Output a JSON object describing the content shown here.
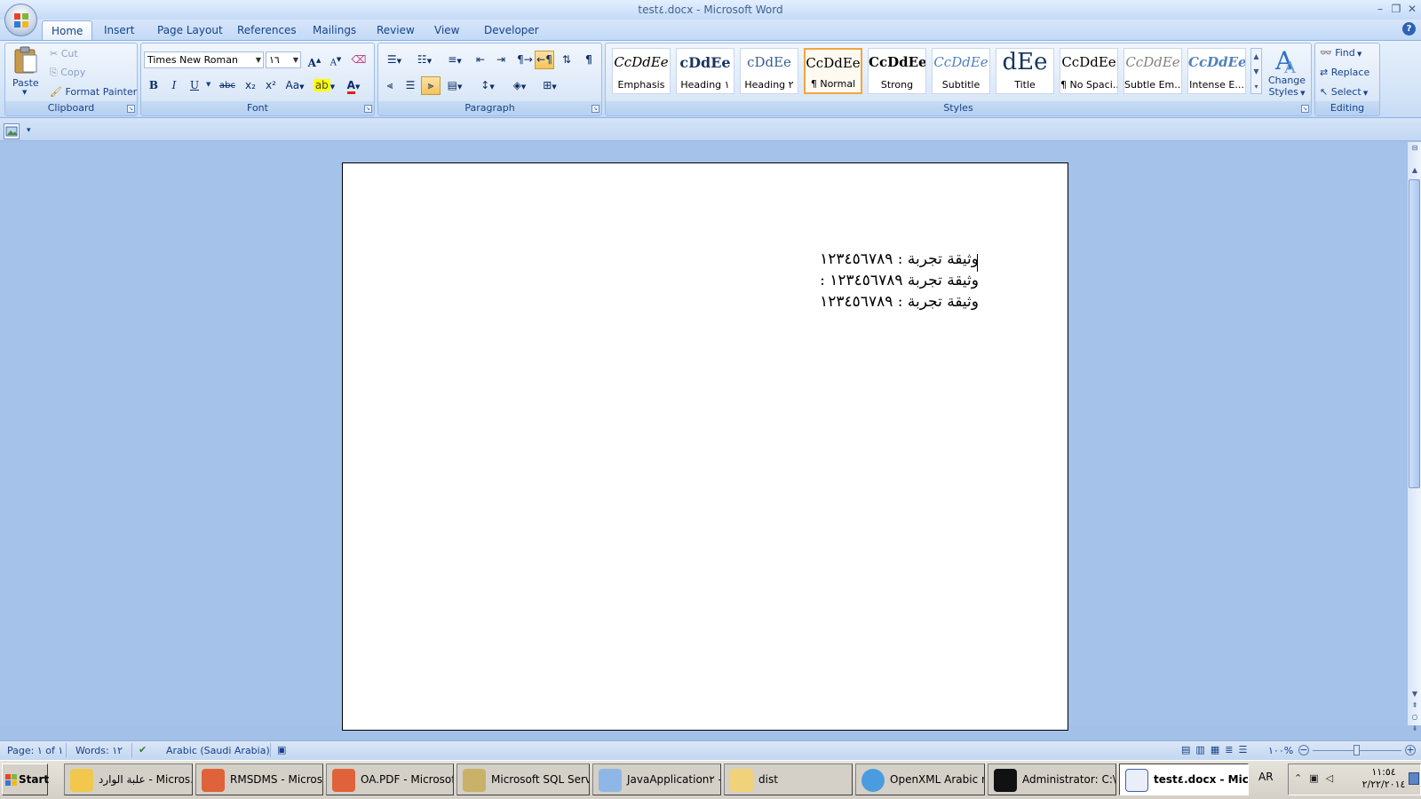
{
  "window": {
    "title": "test٤.docx - Microsoft Word"
  },
  "tabs": [
    "Home",
    "Insert",
    "Page Layout",
    "References",
    "Mailings",
    "Review",
    "View",
    "Developer"
  ],
  "clipboard": {
    "paste": "Paste",
    "cut": "Cut",
    "copy": "Copy",
    "format_painter": "Format Painter",
    "label": "Clipboard"
  },
  "font": {
    "name": "Times New Roman",
    "size": "١٦",
    "label": "Font",
    "bold": "B",
    "italic": "I",
    "underline": "U",
    "strike": "abc",
    "sub": "x₂",
    "sup": "x²",
    "case": "Aa",
    "grow": "A",
    "shrink": "A"
  },
  "paragraph": {
    "label": "Paragraph",
    "pilcrow": "¶"
  },
  "styles": {
    "label": "Styles",
    "items": [
      {
        "preview": "CcDdEe",
        "name": "Emphasis"
      },
      {
        "preview": "cDdEe",
        "name": "Heading ١"
      },
      {
        "preview": "cDdEe",
        "name": "Heading ٢"
      },
      {
        "preview": "CcDdEe",
        "name": "¶ Normal"
      },
      {
        "preview": "CcDdEe",
        "name": "Strong"
      },
      {
        "preview": "CcDdEe",
        "name": "Subtitle"
      },
      {
        "preview": "dEe",
        "name": "Title"
      },
      {
        "preview": "CcDdEe",
        "name": "¶ No Spaci..."
      },
      {
        "preview": "CcDdEe",
        "name": "Subtle Em..."
      },
      {
        "preview": "CcDdEe",
        "name": "Intense E..."
      }
    ],
    "change": "Change",
    "change2": "Styles"
  },
  "editing": {
    "label": "Editing",
    "find": "Find",
    "replace": "Replace",
    "select": "Select"
  },
  "document": {
    "lines": [
      "وثيقة تجربة : ١٢٣٤٥٦٧٨٩",
      "وثيقة تجربة ١٢٣٤٥٦٧٨٩ :",
      "وثيقة تجربة : ١٢٣٤٥٦٧٨٩"
    ]
  },
  "status": {
    "page": "Page: ١ of ١",
    "words": "Words: ١٢",
    "language": "Arabic (Saudi Arabia)",
    "zoom": "١٠٠%"
  },
  "taskbar": {
    "start": "Start",
    "items": [
      "علبة الوارد - Micros...",
      "RMSDMS - Microso...",
      "OA.PDF - Microsof...",
      "Microsoft SQL Serv...",
      "JavaApplication٢ - ...",
      "dist",
      "OpenXML Arabic n...",
      "Administrator: C:\\...",
      "test٤.docx - Mic..."
    ],
    "lang": "AR",
    "time": "١١:٥٤",
    "date": "٢/٢٢/٢٠١٤"
  }
}
